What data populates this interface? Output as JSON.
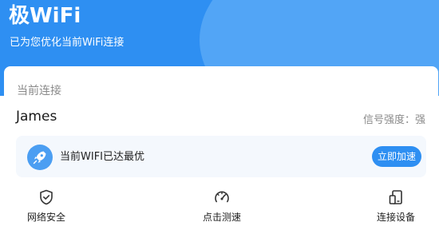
{
  "header": {
    "title": "极WiFi",
    "subtitle": "已为您优化当前WiFi连接"
  },
  "connection": {
    "section_label": "当前连接",
    "network_name": "James",
    "signal_label": "信号强度：强"
  },
  "status": {
    "text": "当前WIFI已达最优",
    "button_label": "立即加速",
    "icon": "rocket-icon"
  },
  "actions": [
    {
      "label": "网络安全",
      "icon": "shield-check-icon"
    },
    {
      "label": "点击测速",
      "icon": "speedometer-icon"
    },
    {
      "label": "连接设备",
      "icon": "devices-icon"
    }
  ],
  "colors": {
    "primary": "#2e8ff2",
    "header_light": "#58a9f7",
    "status_bg": "#f4f8fd"
  }
}
